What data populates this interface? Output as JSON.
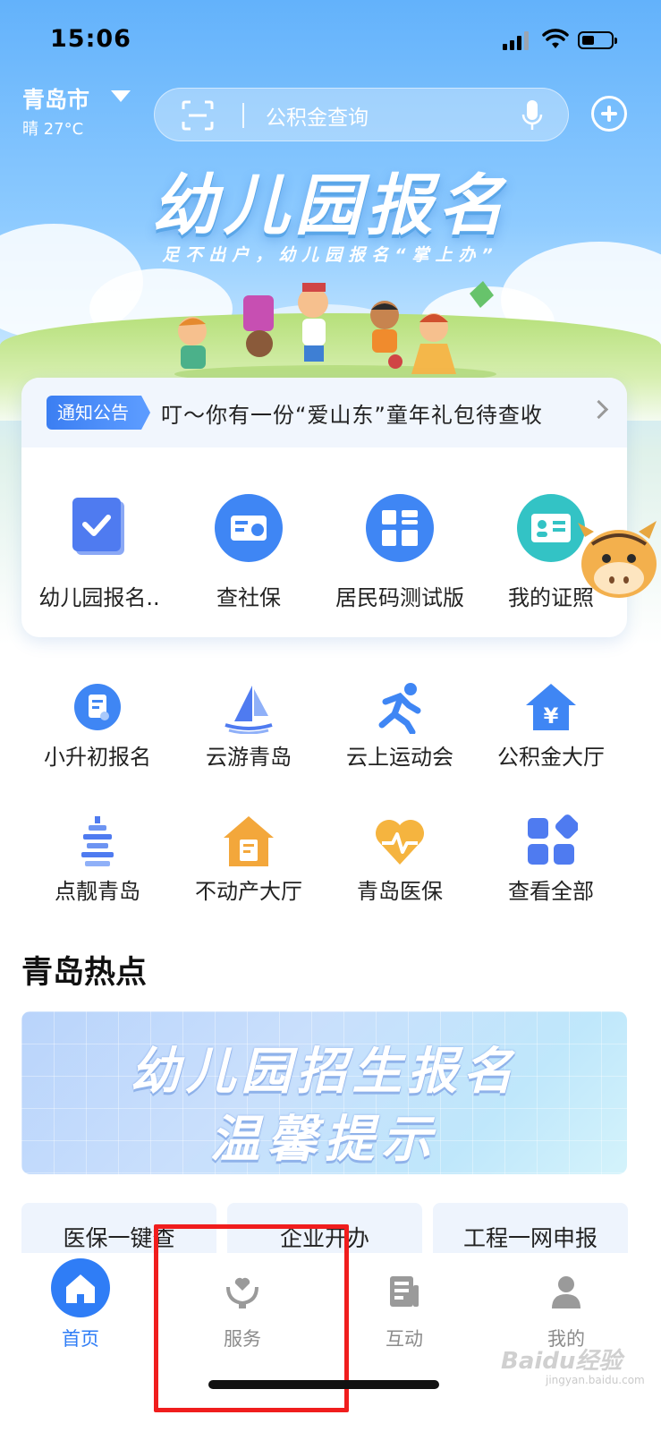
{
  "status_bar": {
    "time": "15:06"
  },
  "header": {
    "city": "青岛市",
    "weather": "晴 27°C",
    "search_placeholder": "公积金查询"
  },
  "banner": {
    "title": "幼儿园报名",
    "subtitle": "足不出户，幼儿园报名“掌上办”"
  },
  "notice": {
    "tag": "通知公告",
    "text": "叮～你有一份“爱山东”童年礼包待查收"
  },
  "top_services": [
    {
      "label": "幼儿园报名..",
      "icon": "book-check-icon"
    },
    {
      "label": "查社保",
      "icon": "social-security-card-icon"
    },
    {
      "label": "居民码测试版",
      "icon": "qr-code-icon"
    },
    {
      "label": "我的证照",
      "icon": "id-card-icon"
    }
  ],
  "services": [
    {
      "label": "小升初报名",
      "icon": "enroll-badge-icon"
    },
    {
      "label": "云游青岛",
      "icon": "sailboat-icon"
    },
    {
      "label": "云上运动会",
      "icon": "runner-icon"
    },
    {
      "label": "公积金大厅",
      "icon": "house-yen-icon"
    },
    {
      "label": "点靓青岛",
      "icon": "tower-icon"
    },
    {
      "label": "不动产大厅",
      "icon": "house-document-icon"
    },
    {
      "label": "青岛医保",
      "icon": "heart-pulse-icon"
    },
    {
      "label": "查看全部",
      "icon": "grid-apps-icon"
    }
  ],
  "hot": {
    "title": "青岛热点",
    "promo_line1": "幼儿园招生报名",
    "promo_line2": "温馨提示"
  },
  "quick_links": [
    {
      "label": "医保一键查"
    },
    {
      "label": "企业开办"
    },
    {
      "label": "工程一网申报"
    }
  ],
  "tabs": [
    {
      "label": "首页",
      "icon": "home-icon",
      "active": true
    },
    {
      "label": "服务",
      "icon": "service-hands-icon",
      "active": false
    },
    {
      "label": "互动",
      "icon": "news-icon",
      "active": false
    },
    {
      "label": "我的",
      "icon": "user-icon",
      "active": false
    }
  ],
  "watermark": {
    "text": "Baidu经验",
    "url": "jingyan.baidu.com"
  },
  "colors": {
    "accent": "#2f7df6",
    "highlight": "#f01d1d"
  }
}
